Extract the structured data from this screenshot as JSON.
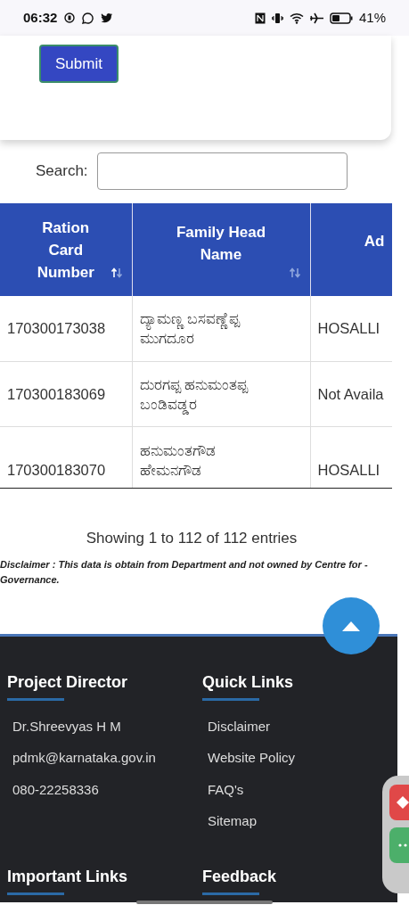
{
  "status_bar": {
    "time": "06:32",
    "battery": "41%"
  },
  "form": {
    "submit": "Submit"
  },
  "search": {
    "label": "Search:"
  },
  "table": {
    "columns": [
      {
        "label": "Ration Card Number",
        "sorted": true
      },
      {
        "label": "Family Head Name",
        "sorted": false
      },
      {
        "label": "Ad"
      }
    ],
    "rows": [
      [
        "170300173038",
        "ದ್ಯಾಮಣ್ಣ ಬಸವಣ್ಣೆಪ್ಪ ಮುಗದೂರ",
        "HOSALLI"
      ],
      [
        "170300183069",
        "ದುರಗಪ್ಪ ಹನುಮಂತಪ್ಪ ಬಂಡಿವಡ್ಡರ",
        "Not Availa"
      ],
      [
        "170300183070",
        "ಹನುಮಂತಗೌಡ ಹೇಮನಗೌಡ",
        "HOSALLI"
      ]
    ]
  },
  "info": "Showing 1 to 112 of 112 entries",
  "disclaimer": "Disclaimer : This data is obtain from Department and not owned by Centre for -Governance.",
  "footer": {
    "sections": [
      {
        "title": "Project Director",
        "items": [
          "Dr.Shreevyas H M",
          "pdmk@karnataka.gov.in",
          "080-22258336"
        ]
      },
      {
        "title": "Quick Links",
        "items": [
          "Disclaimer",
          "Website Policy",
          "FAQ's",
          "Sitemap"
        ]
      },
      {
        "title": "Important Links"
      },
      {
        "title": "Feedback"
      }
    ]
  }
}
